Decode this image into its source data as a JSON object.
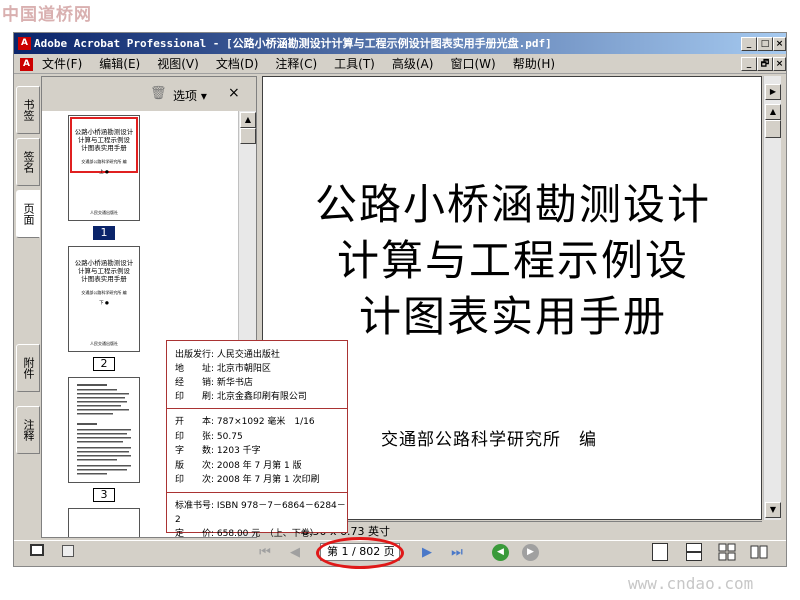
{
  "watermark_top": "中国道桥网",
  "watermark_bottom": "www.cndao.com",
  "window": {
    "title": "Adobe Acrobat Professional - [公路小桥涵勘测设计计算与工程示例设计图表实用手册光盘.pdf]",
    "buttons": [
      "_",
      "□",
      "×"
    ],
    "doc_buttons": [
      "_",
      "🗗",
      "×"
    ]
  },
  "menu": [
    "文件(F)",
    "编辑(E)",
    "视图(V)",
    "文档(D)",
    "注释(C)",
    "工具(T)",
    "高级(A)",
    "窗口(W)",
    "帮助(H)"
  ],
  "side_tabs": [
    "书签",
    "签名",
    "页面",
    "附件",
    "注释"
  ],
  "panel": {
    "options_label": "选项",
    "options_arrow": "▾",
    "close": "×"
  },
  "thumbnails": [
    {
      "lines": [
        "公路小桥涵勘测设计",
        "计算与工程示例设",
        "计图表实用手册"
      ],
      "author": "交通部公路科学研究所 编",
      "mark": "上 ●",
      "publisher": "人民交通出版社",
      "page": "1",
      "selected": true
    },
    {
      "lines": [
        "公路小桥涵勘测设计",
        "计算与工程示例设",
        "计图表实用手册"
      ],
      "author": "交通部公路科学研究所 编",
      "mark": "下 ●",
      "publisher": "人民交通出版社",
      "page": "2",
      "selected": false
    },
    {
      "lines": [],
      "author": "",
      "mark": "",
      "publisher": "",
      "page": "3",
      "selected": false
    }
  ],
  "document": {
    "title_lines": [
      "公路小桥涵勘测设计",
      "计算与工程示例设",
      "计图表实用手册"
    ],
    "author": "交通部公路科学研究所　编",
    "size_label": "8.50 x 6.73 英寸"
  },
  "imprint": {
    "top": [
      {
        "k": "出版发行:",
        "v": "人民交通出版社"
      },
      {
        "k": "地　　址:",
        "v": "北京市朝阳区"
      },
      {
        "k": "经　　销:",
        "v": "新华书店"
      },
      {
        "k": "印　　刷:",
        "v": "北京金鑫印刷有限公司"
      }
    ],
    "mid": [
      {
        "k": "开　　本:",
        "v": "787×1092 毫米　1/16"
      },
      {
        "k": "印　　张:",
        "v": "50.75"
      },
      {
        "k": "字　　数:",
        "v": "1203 千字"
      },
      {
        "k": "版　　次:",
        "v": "2008 年 7 月第 1 版"
      },
      {
        "k": "印　　次:",
        "v": "2008 年 7 月第 1 次印刷"
      }
    ],
    "bottom": [
      {
        "k": "标准书号:",
        "v": "ISBN 978－7－6864－6284－2"
      },
      {
        "k": "定　　价:",
        "v": "658.00 元　（上、下卷）"
      }
    ]
  },
  "nav": {
    "first": "⏮",
    "prev": "◀",
    "next": "▶",
    "last": "⏭",
    "page_display": "第 1 / 802 页",
    "back": "◀",
    "forward": "▶"
  },
  "colors": {
    "accent_oval": "#e01818",
    "title_bar": "#0a246a",
    "selected_page": "#0a246a"
  }
}
